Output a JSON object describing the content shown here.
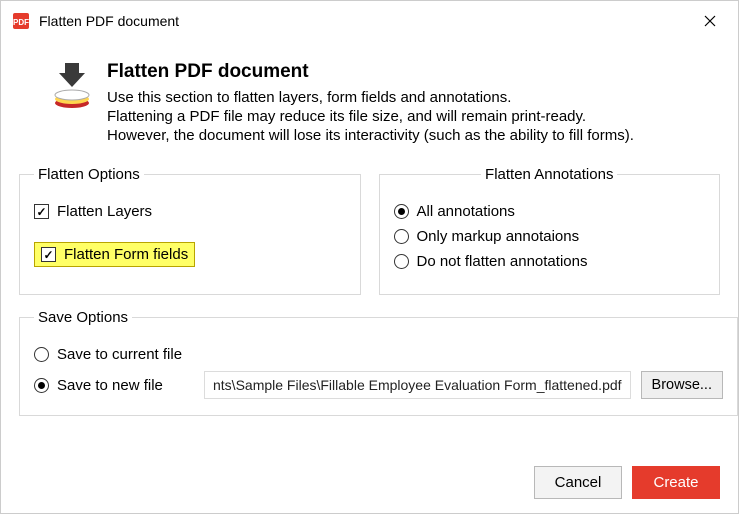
{
  "window": {
    "title": "Flatten PDF document"
  },
  "header": {
    "title": "Flatten PDF document",
    "line1": "Use this section to flatten layers, form fields and annotations.",
    "line2": "Flattening a PDF file may reduce its file size, and will remain print-ready.",
    "line3": "However, the document will lose its interactivity (such as the ability to fill forms)."
  },
  "flatten_options": {
    "legend": "Flatten Options",
    "layers": {
      "label": "Flatten Layers",
      "checked": true
    },
    "form_fields": {
      "label": "Flatten Form fields",
      "checked": true,
      "highlighted": true
    }
  },
  "flatten_annotations": {
    "legend": "Flatten Annotations",
    "selected": "all",
    "all": "All annotations",
    "markup": "Only markup annotaions",
    "none": "Do not flatten annotations"
  },
  "save_options": {
    "legend": "Save Options",
    "selected": "new",
    "current": "Save to current file",
    "new": "Save to new file",
    "path": "nts\\Sample Files\\Fillable Employee Evaluation Form_flattened.pdf",
    "browse": "Browse..."
  },
  "buttons": {
    "cancel": "Cancel",
    "create": "Create"
  }
}
